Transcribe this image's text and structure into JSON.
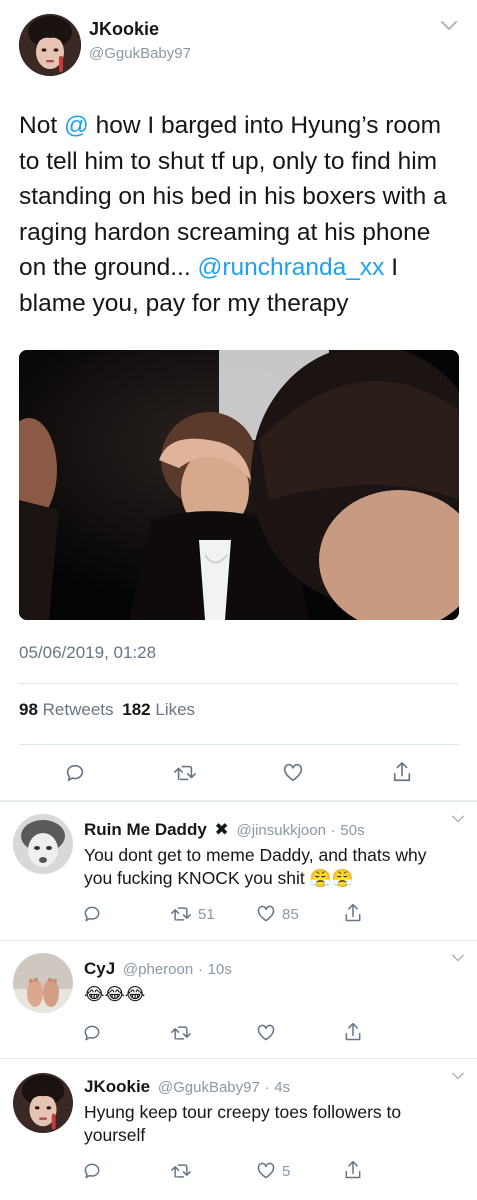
{
  "main_tweet": {
    "author_name": "JKookie",
    "handle": "@GgukBaby97",
    "text_parts": [
      {
        "t": "Not ",
        "link": false
      },
      {
        "t": "@",
        "link": true
      },
      {
        "t": " how I barged into Hyung’s room to tell him to shut tf up, only to find him standing on his bed in his boxers with a raging hardon screaming at his phone on the ground... ",
        "link": false
      },
      {
        "t": "@runchranda_xx",
        "link": true
      },
      {
        "t": " I blame you, pay for my therapy",
        "link": false
      }
    ],
    "timestamp": "05/06/2019, 01:28",
    "retweet_count": "98",
    "retweet_label": "Retweets",
    "like_count": "182",
    "like_label": "Likes"
  },
  "replies": [
    {
      "name": "Ruin Me Daddy",
      "badge": "✖",
      "handle": "@jinsukkjoon",
      "sep": "·",
      "time": "50s",
      "text": "You dont get to meme Daddy, and thats why you fucking KNOCK you shit 😤😤",
      "retweets": "51",
      "likes": "85"
    },
    {
      "name": "CyJ",
      "handle": "@pheroon",
      "sep": "·",
      "time": "10s",
      "text": "😂😂😂",
      "retweets": "",
      "likes": ""
    },
    {
      "name": "JKookie",
      "handle": "@GgukBaby97",
      "sep": "·",
      "time": "4s",
      "text": "Hyung keep tour creepy toes followers to yourself",
      "retweets": "",
      "likes": "5"
    }
  ],
  "icons": {
    "reply": "reply-icon",
    "retweet": "retweet-icon",
    "like": "like-icon",
    "share": "share-icon",
    "more": "chevron-down-icon"
  },
  "colors": {
    "link": "#1da1f2",
    "muted": "#8899a6",
    "divider": "#e1e8ed",
    "text": "#14171a"
  }
}
